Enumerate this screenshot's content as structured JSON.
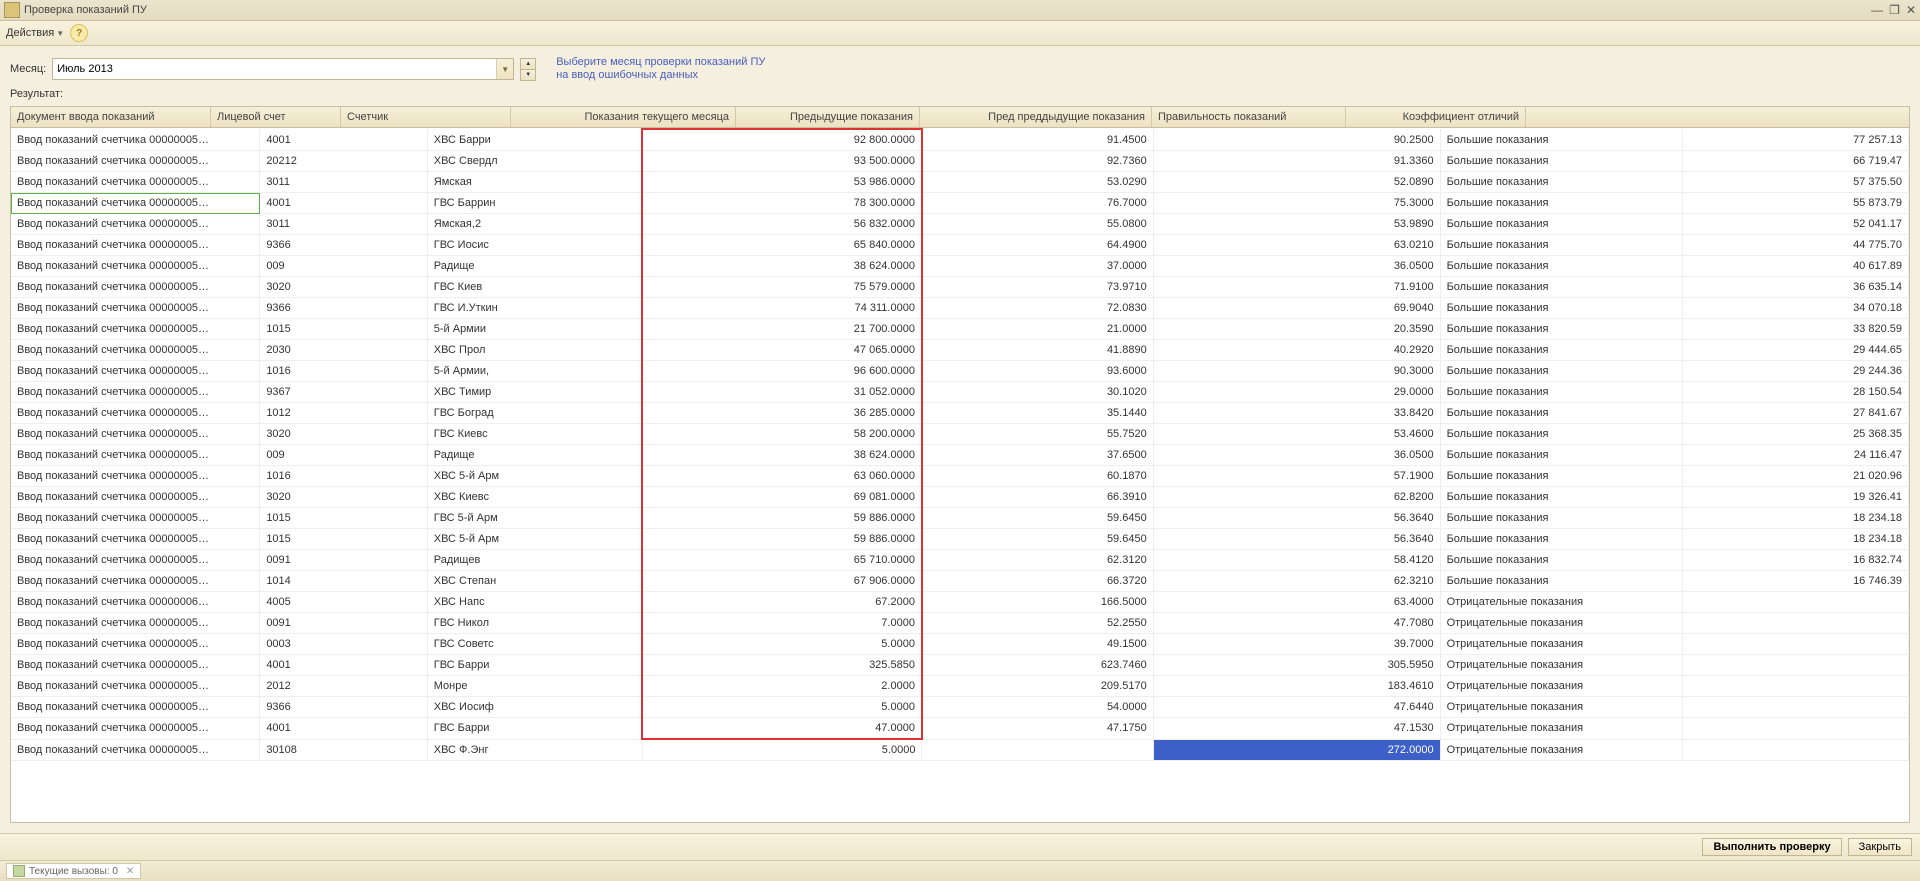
{
  "title": "Проверка показаний ПУ",
  "toolbar": {
    "actions_label": "Действия"
  },
  "month_label": "Месяц:",
  "month_value": "Июль 2013",
  "hint_line1": "Выберите месяц проверки показаний ПУ",
  "hint_line2": "на ввод ошибочных данных",
  "result_label": "Результат:",
  "columns": [
    "Документ ввода показаний",
    "Лицевой счет",
    "Счетчик",
    "Показания текущего месяца",
    "Предыдущие показания",
    "Пред преддыдущие показания",
    "Правильность показаний",
    "Коэффициент отличий"
  ],
  "rows": [
    {
      "doc": "Ввод показаний счетчика 00000005…",
      "acc": "4001",
      "meter": "ХВС Барри",
      "cur": "92 800.0000",
      "prev": "91.4500",
      "pprev": "90.2500",
      "status": "Большие показания",
      "coef": "77 257.13"
    },
    {
      "doc": "Ввод показаний счетчика 00000005…",
      "acc": "20212",
      "meter": "ХВС Свердл",
      "cur": "93 500.0000",
      "prev": "92.7360",
      "pprev": "91.3360",
      "status": "Большие показания",
      "coef": "66 719.47"
    },
    {
      "doc": "Ввод показаний счетчика 00000005…",
      "acc": "3011",
      "meter": "Ямская",
      "cur": "53 986.0000",
      "prev": "53.0290",
      "pprev": "52.0890",
      "status": "Большие показания",
      "coef": "57 375.50"
    },
    {
      "doc": "Ввод показаний счетчика 00000005…",
      "acc": "4001",
      "meter": "ГВС Баррин",
      "cur": "78 300.0000",
      "prev": "76.7000",
      "pprev": "75.3000",
      "status": "Большие показания",
      "coef": "55 873.79",
      "highlight": "green"
    },
    {
      "doc": "Ввод показаний счетчика 00000005…",
      "acc": "3011",
      "meter": "Ямская,2",
      "cur": "56 832.0000",
      "prev": "55.0800",
      "pprev": "53.9890",
      "status": "Большие показания",
      "coef": "52 041.17"
    },
    {
      "doc": "Ввод показаний счетчика 00000005…",
      "acc": "9366",
      "meter": "ГВС Иосис",
      "cur": "65 840.0000",
      "prev": "64.4900",
      "pprev": "63.0210",
      "status": "Большие показания",
      "coef": "44 775.70"
    },
    {
      "doc": "Ввод показаний счетчика 00000005…",
      "acc": "009",
      "meter": "Радище",
      "cur": "38 624.0000",
      "prev": "37.0000",
      "pprev": "36.0500",
      "status": "Большие показания",
      "coef": "40 617.89"
    },
    {
      "doc": "Ввод показаний счетчика 00000005…",
      "acc": "3020",
      "meter": "ГВС Киев",
      "cur": "75 579.0000",
      "prev": "73.9710",
      "pprev": "71.9100",
      "status": "Большие показания",
      "coef": "36 635.14"
    },
    {
      "doc": "Ввод показаний счетчика 00000005…",
      "acc": "9366",
      "meter": "ГВС И.Уткин",
      "cur": "74 311.0000",
      "prev": "72.0830",
      "pprev": "69.9040",
      "status": "Большие показания",
      "coef": "34 070.18"
    },
    {
      "doc": "Ввод показаний счетчика 00000005…",
      "acc": "1015",
      "meter": "5-й Армии",
      "cur": "21 700.0000",
      "prev": "21.0000",
      "pprev": "20.3590",
      "status": "Большие показания",
      "coef": "33 820.59"
    },
    {
      "doc": "Ввод показаний счетчика 00000005…",
      "acc": "2030",
      "meter": "ХВС Прол",
      "cur": "47 065.0000",
      "prev": "41.8890",
      "pprev": "40.2920",
      "status": "Большие показания",
      "coef": "29 444.65"
    },
    {
      "doc": "Ввод показаний счетчика 00000005…",
      "acc": "1016",
      "meter": "5-й Армии,",
      "cur": "96 600.0000",
      "prev": "93.6000",
      "pprev": "90.3000",
      "status": "Большие показания",
      "coef": "29 244.36"
    },
    {
      "doc": "Ввод показаний счетчика 00000005…",
      "acc": "9367",
      "meter": "ХВС Тимир",
      "cur": "31 052.0000",
      "prev": "30.1020",
      "pprev": "29.0000",
      "status": "Большие показания",
      "coef": "28 150.54"
    },
    {
      "doc": "Ввод показаний счетчика 00000005…",
      "acc": "1012",
      "meter": "ГВС Боград",
      "cur": "36 285.0000",
      "prev": "35.1440",
      "pprev": "33.8420",
      "status": "Большие показания",
      "coef": "27 841.67"
    },
    {
      "doc": "Ввод показаний счетчика 00000005…",
      "acc": "3020",
      "meter": "ГВС Киевс",
      "cur": "58 200.0000",
      "prev": "55.7520",
      "pprev": "53.4600",
      "status": "Большие показания",
      "coef": "25 368.35"
    },
    {
      "doc": "Ввод показаний счетчика 00000005…",
      "acc": "009",
      "meter": "Радище",
      "cur": "38 624.0000",
      "prev": "37.6500",
      "pprev": "36.0500",
      "status": "Большие показания",
      "coef": "24 116.47"
    },
    {
      "doc": "Ввод показаний счетчика 00000005…",
      "acc": "1016",
      "meter": "ХВС 5-й Арм",
      "cur": "63 060.0000",
      "prev": "60.1870",
      "pprev": "57.1900",
      "status": "Большие показания",
      "coef": "21 020.96"
    },
    {
      "doc": "Ввод показаний счетчика 00000005…",
      "acc": "3020",
      "meter": "ХВС Киевс",
      "cur": "69 081.0000",
      "prev": "66.3910",
      "pprev": "62.8200",
      "status": "Большие показания",
      "coef": "19 326.41"
    },
    {
      "doc": "Ввод показаний счетчика 00000005…",
      "acc": "1015",
      "meter": "ГВС 5-й Арм",
      "cur": "59 886.0000",
      "prev": "59.6450",
      "pprev": "56.3640",
      "status": "Большие показания",
      "coef": "18 234.18"
    },
    {
      "doc": "Ввод показаний счетчика 00000005…",
      "acc": "1015",
      "meter": "ХВС 5-й Арм",
      "cur": "59 886.0000",
      "prev": "59.6450",
      "pprev": "56.3640",
      "status": "Большие показания",
      "coef": "18 234.18"
    },
    {
      "doc": "Ввод показаний счетчика 00000005…",
      "acc": "0091",
      "meter": "Радищев",
      "cur": "65 710.0000",
      "prev": "62.3120",
      "pprev": "58.4120",
      "status": "Большие показания",
      "coef": "16 832.74"
    },
    {
      "doc": "Ввод показаний счетчика 00000005…",
      "acc": "1014",
      "meter": "ХВС Степан",
      "cur": "67 906.0000",
      "prev": "66.3720",
      "pprev": "62.3210",
      "status": "Большие показания",
      "coef": "16 746.39"
    },
    {
      "doc": "Ввод показаний счетчика 00000006…",
      "acc": "4005",
      "meter": "ХВС Напс",
      "cur": "67.2000",
      "prev": "166.5000",
      "pprev": "63.4000",
      "status": "Отрицательные показания",
      "coef": ""
    },
    {
      "doc": "Ввод показаний счетчика 00000005…",
      "acc": "0091",
      "meter": "ГВС Никол",
      "cur": "7.0000",
      "prev": "52.2550",
      "pprev": "47.7080",
      "status": "Отрицательные показания",
      "coef": ""
    },
    {
      "doc": "Ввод показаний счетчика 00000005…",
      "acc": "0003",
      "meter": "ГВС Советс",
      "cur": "5.0000",
      "prev": "49.1500",
      "pprev": "39.7000",
      "status": "Отрицательные показания",
      "coef": ""
    },
    {
      "doc": "Ввод показаний счетчика 00000005…",
      "acc": "4001",
      "meter": "ГВС Барри",
      "cur": "325.5850",
      "prev": "623.7460",
      "pprev": "305.5950",
      "status": "Отрицательные показания",
      "coef": ""
    },
    {
      "doc": "Ввод показаний счетчика 00000005…",
      "acc": "2012",
      "meter": "Монре",
      "cur": "2.0000",
      "prev": "209.5170",
      "pprev": "183.4610",
      "status": "Отрицательные показания",
      "coef": ""
    },
    {
      "doc": "Ввод показаний счетчика 00000005…",
      "acc": "9366",
      "meter": "ХВС Иосиф",
      "cur": "5.0000",
      "prev": "54.0000",
      "pprev": "47.6440",
      "status": "Отрицательные показания",
      "coef": ""
    },
    {
      "doc": "Ввод показаний счетчика 00000005…",
      "acc": "4001",
      "meter": "ГВС Барри",
      "cur": "47.0000",
      "prev": "47.1750",
      "pprev": "47.1530",
      "status": "Отрицательные показания",
      "coef": ""
    },
    {
      "doc": "Ввод показаний счетчика 00000005…",
      "acc": "30108",
      "meter": "ХВС Ф.Энг",
      "cur": "5.0000",
      "prev": "",
      "pprev": "272.0000",
      "status": "Отрицательные показания",
      "coef": "",
      "selcell": 5
    }
  ],
  "buttons": {
    "run": "Выполнить проверку",
    "close": "Закрыть"
  },
  "status_tab": "Текущие вызовы: 0"
}
